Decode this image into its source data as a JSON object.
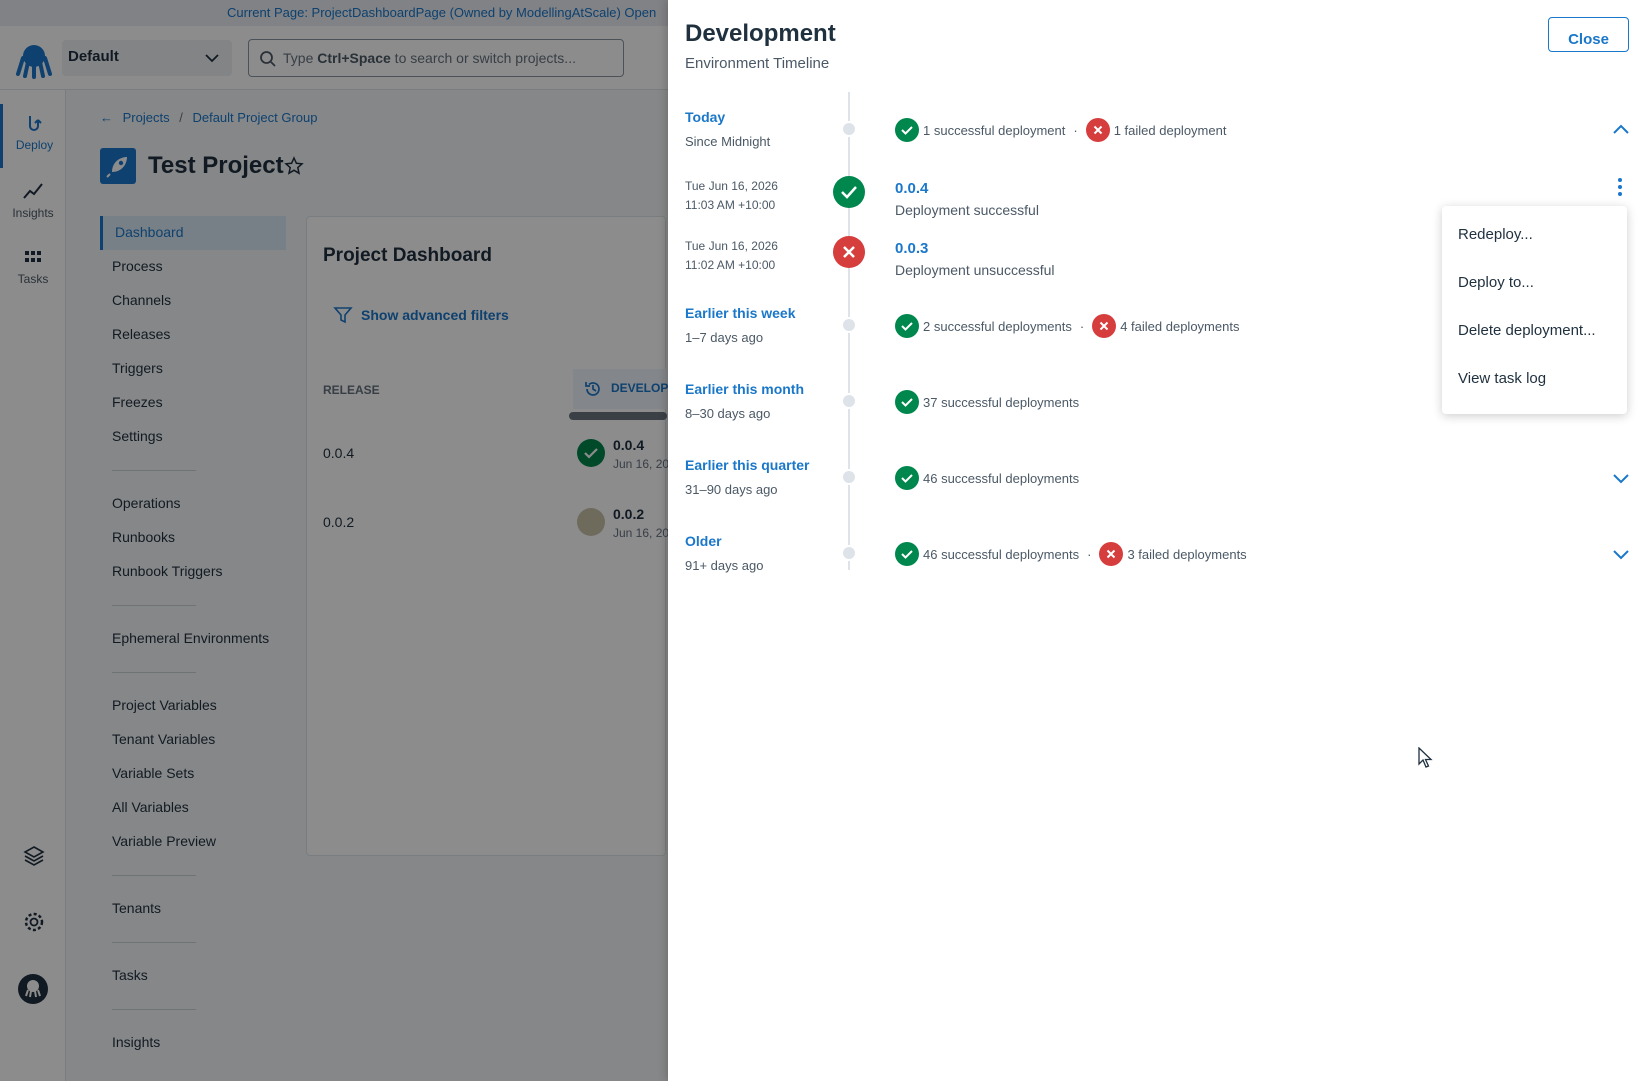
{
  "topbar": {
    "text": "Current Page: ProjectDashboardPage (Owned by ModellingAtScale)    Open"
  },
  "header": {
    "space": "Default",
    "search": {
      "prefix": "Type ",
      "shortcut": "Ctrl+Space",
      "suffix": " to search or switch projects..."
    }
  },
  "rail": {
    "deploy": "Deploy",
    "insights": "Insights",
    "tasks": "Tasks"
  },
  "breadcrumb": {
    "projects": "Projects",
    "sep": "/",
    "group": "Default Project Group"
  },
  "project": {
    "title": "Test Project"
  },
  "subnav": {
    "dashboard": "Dashboard",
    "process": "Process",
    "channels": "Channels",
    "releases": "Releases",
    "triggers": "Triggers",
    "freezes": "Freezes",
    "settings": "Settings",
    "operations": "Operations",
    "runbooks": "Runbooks",
    "runbook_triggers": "Runbook Triggers",
    "ephemeral": "Ephemeral Environments",
    "project_variables": "Project Variables",
    "tenant_variables": "Tenant Variables",
    "variable_sets": "Variable Sets",
    "all_variables": "All Variables",
    "variable_preview": "Variable Preview",
    "tenants": "Tenants",
    "tasks": "Tasks",
    "insights": "Insights"
  },
  "dashboard": {
    "title": "Project Dashboard",
    "filters": "Show advanced filters",
    "col_release": "RELEASE",
    "col_env": "DEVELOP",
    "rows": [
      {
        "release": "0.0.4",
        "version": "0.0.4",
        "date": "Jun 16, 20"
      },
      {
        "release": "0.0.2",
        "version": "0.0.2",
        "date": "Jun 16, 20"
      }
    ]
  },
  "drawer": {
    "title": "Development",
    "subtitle": "Environment Timeline",
    "close": "Close",
    "groups": {
      "today": {
        "label": "Today",
        "sub": "Since Midnight",
        "ok": "1 successful deployment",
        "fail": "1 failed deployment"
      },
      "week": {
        "label": "Earlier this week",
        "sub": "1–7 days ago",
        "ok": "2 successful deployments",
        "fail": "4 failed deployments"
      },
      "month": {
        "label": "Earlier this month",
        "sub": "8–30 days ago",
        "ok": "37 successful deployments"
      },
      "quarter": {
        "label": "Earlier this quarter",
        "sub": "31–90 days ago",
        "ok": "46 successful deployments"
      },
      "older": {
        "label": "Older",
        "sub": "91+ days ago",
        "ok": "46 successful deployments",
        "fail": "3 failed deployments"
      }
    },
    "deployments": [
      {
        "date": "Tue Jun 16, 2026",
        "time": "11:03 AM +10:00",
        "version": "0.0.4",
        "status": "Deployment successful"
      },
      {
        "date": "Tue Jun 16, 2026",
        "time": "11:02 AM +10:00",
        "version": "0.0.3",
        "status": "Deployment unsuccessful"
      }
    ],
    "menu": {
      "redeploy": "Redeploy...",
      "deploy_to": "Deploy to...",
      "delete": "Delete deployment...",
      "task_log": "View task log"
    }
  },
  "colors": {
    "accent": "#1a77ca",
    "success": "#00874d",
    "failure": "#d63d3d"
  }
}
